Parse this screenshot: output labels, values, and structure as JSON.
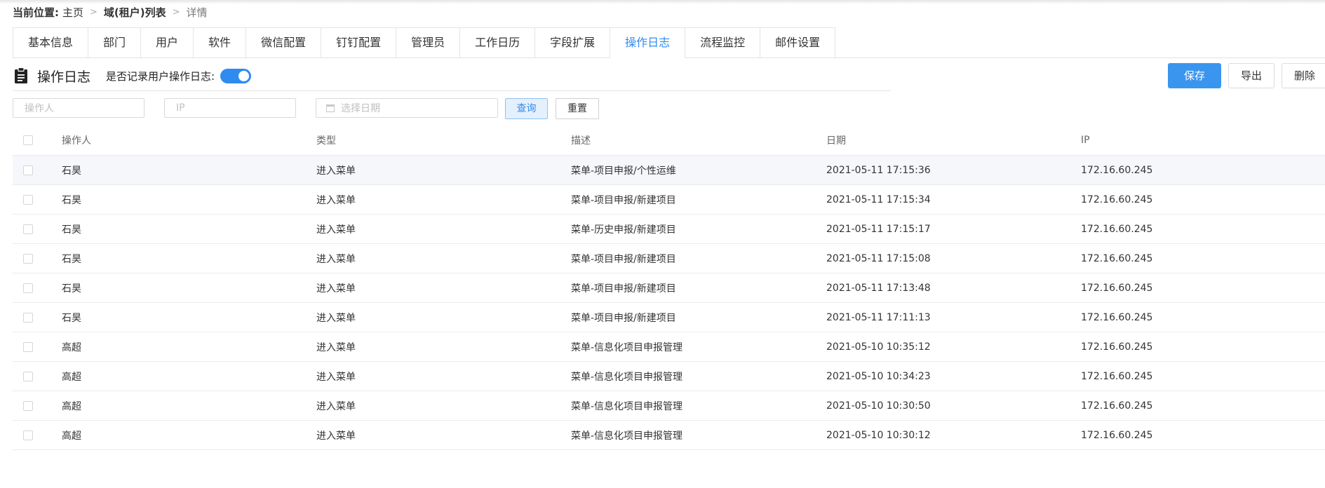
{
  "breadcrumb": {
    "label": "当前位置:",
    "items": [
      "主页",
      "域(租户)列表",
      "详情"
    ]
  },
  "tabs": [
    {
      "label": "基本信息",
      "active": false
    },
    {
      "label": "部门",
      "active": false
    },
    {
      "label": "用户",
      "active": false
    },
    {
      "label": "软件",
      "active": false
    },
    {
      "label": "微信配置",
      "active": false
    },
    {
      "label": "钉钉配置",
      "active": false
    },
    {
      "label": "管理员",
      "active": false
    },
    {
      "label": "工作日历",
      "active": false
    },
    {
      "label": "字段扩展",
      "active": false
    },
    {
      "label": "操作日志",
      "active": true
    },
    {
      "label": "流程监控",
      "active": false
    },
    {
      "label": "邮件设置",
      "active": false
    }
  ],
  "section": {
    "icon": "clipboard-icon",
    "title": "操作日志",
    "toggle_label": "是否记录用户操作日志:",
    "toggle_on": true
  },
  "actions": {
    "save": "保存",
    "export": "导出",
    "delete": "删除"
  },
  "filters": {
    "operator_placeholder": "操作人",
    "ip_placeholder": "IP",
    "date_placeholder": "选择日期",
    "date_icon": "calendar-icon",
    "query": "查询",
    "reset": "重置"
  },
  "table": {
    "columns": [
      "操作人",
      "类型",
      "描述",
      "日期",
      "IP"
    ],
    "rows": [
      {
        "operator": "石昊",
        "type": "进入菜单",
        "desc": "菜单-项目申报/个性运维",
        "date": "2021-05-11 17:15:36",
        "ip": "172.16.60.245"
      },
      {
        "operator": "石昊",
        "type": "进入菜单",
        "desc": "菜单-项目申报/新建项目",
        "date": "2021-05-11 17:15:34",
        "ip": "172.16.60.245"
      },
      {
        "operator": "石昊",
        "type": "进入菜单",
        "desc": "菜单-历史申报/新建项目",
        "date": "2021-05-11 17:15:17",
        "ip": "172.16.60.245"
      },
      {
        "operator": "石昊",
        "type": "进入菜单",
        "desc": "菜单-项目申报/新建项目",
        "date": "2021-05-11 17:15:08",
        "ip": "172.16.60.245"
      },
      {
        "operator": "石昊",
        "type": "进入菜单",
        "desc": "菜单-项目申报/新建项目",
        "date": "2021-05-11 17:13:48",
        "ip": "172.16.60.245"
      },
      {
        "operator": "石昊",
        "type": "进入菜单",
        "desc": "菜单-项目申报/新建项目",
        "date": "2021-05-11 17:11:13",
        "ip": "172.16.60.245"
      },
      {
        "operator": "高超",
        "type": "进入菜单",
        "desc": "菜单-信息化项目申报管理",
        "date": "2021-05-10 10:35:12",
        "ip": "172.16.60.245"
      },
      {
        "operator": "高超",
        "type": "进入菜单",
        "desc": "菜单-信息化项目申报管理",
        "date": "2021-05-10 10:34:23",
        "ip": "172.16.60.245"
      },
      {
        "operator": "高超",
        "type": "进入菜单",
        "desc": "菜单-信息化项目申报管理",
        "date": "2021-05-10 10:30:50",
        "ip": "172.16.60.245"
      },
      {
        "operator": "高超",
        "type": "进入菜单",
        "desc": "菜单-信息化项目申报管理",
        "date": "2021-05-10 10:30:12",
        "ip": "172.16.60.245"
      }
    ]
  },
  "colors": {
    "accent": "#2f8bf0",
    "primary_button": "#3a95ef",
    "row_highlight": "#f5f7fa"
  }
}
